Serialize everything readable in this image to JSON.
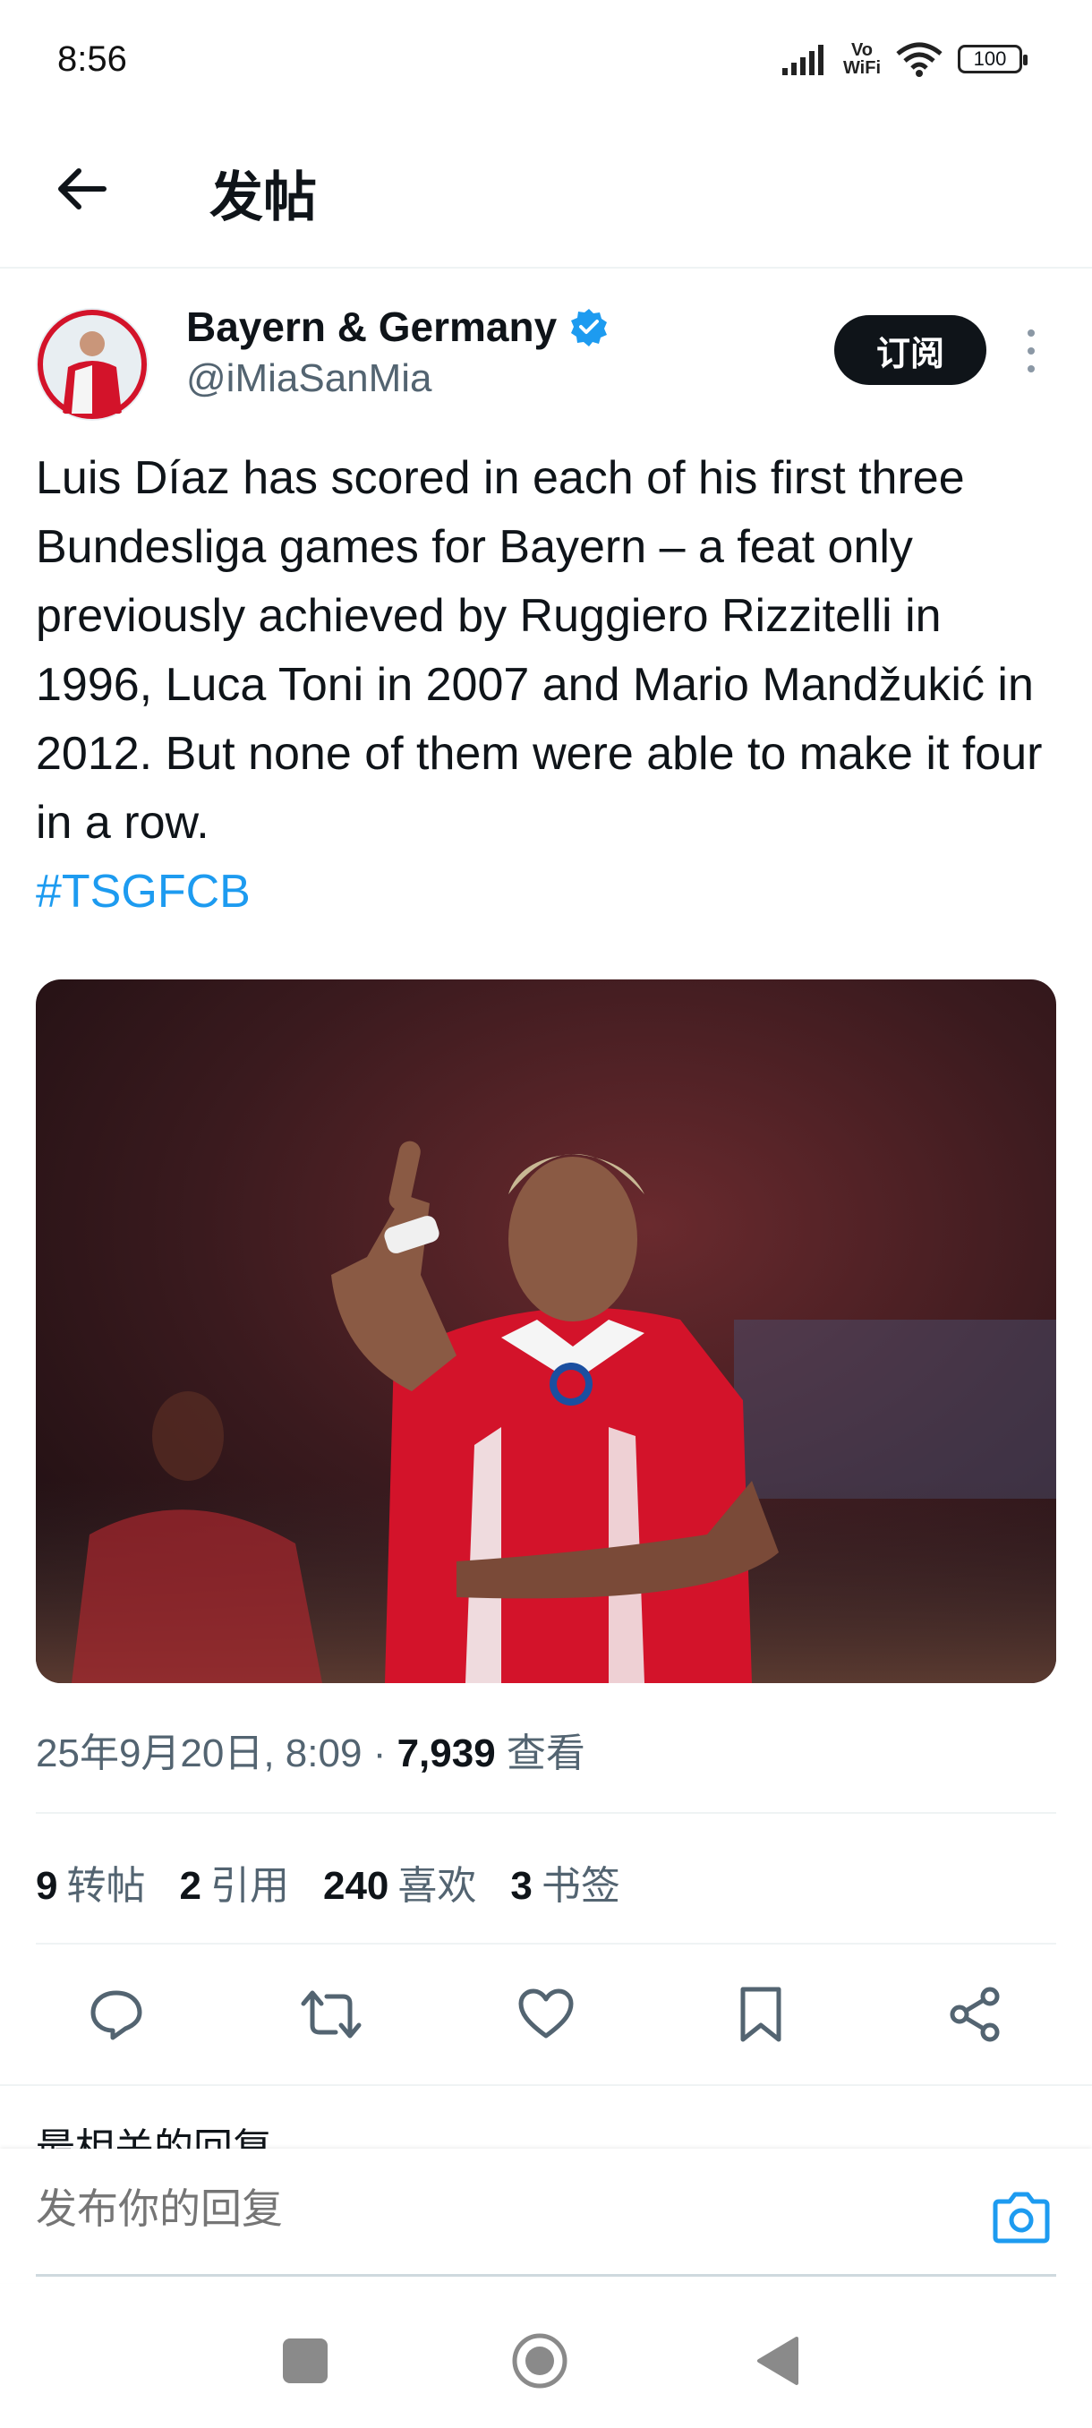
{
  "status_bar": {
    "time": "8:56",
    "vowifi_line1": "Vo",
    "vowifi_line2": "WiFi",
    "battery": "100"
  },
  "header": {
    "title": "发帖"
  },
  "author": {
    "name": "Bayern & Germany",
    "handle": "@iMiaSanMia",
    "subscribe_label": "订阅",
    "verified": true
  },
  "tweet": {
    "text": "Luis Díaz has scored in each of his first three Bundesliga games for Bayern – a feat only previously achieved by Ruggiero Rizzitelli in 1996, Luca Toni in 2007 and Mario Mandžukić in 2012. But none of them were able to make it four in a row.",
    "hashtag": "#TSGFCB"
  },
  "meta": {
    "date": "25年9月20日, 8:09",
    "separator": "·",
    "views": "7,939",
    "views_label": "查看"
  },
  "stats": {
    "retweets": "9",
    "retweets_label": "转帖",
    "quotes": "2",
    "quotes_label": "引用",
    "likes": "240",
    "likes_label": "喜欢",
    "bookmarks": "3",
    "bookmarks_label": "书签"
  },
  "related": {
    "heading": "最相关的回复"
  },
  "reply": {
    "placeholder": "发布你的回复"
  },
  "colors": {
    "accent": "#1d9bf0",
    "text": "#0f1419",
    "secondary": "#536471",
    "jersey_red": "#d3132a"
  },
  "icons": [
    "back-arrow-icon",
    "verified-badge-icon",
    "more-icon",
    "reply-icon",
    "retweet-icon",
    "like-icon",
    "bookmark-icon",
    "share-icon",
    "camera-icon"
  ]
}
